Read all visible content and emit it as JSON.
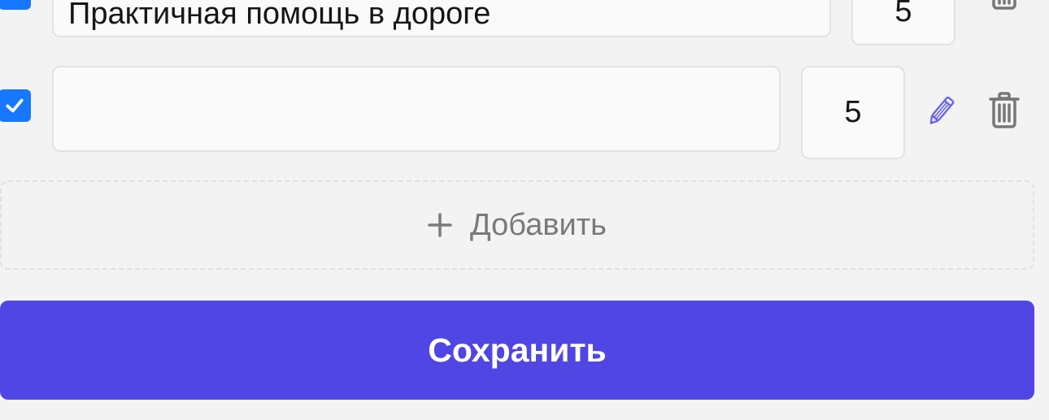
{
  "rows": [
    {
      "checked": true,
      "text": "Практичная помощь в дороге",
      "quantity": "5"
    },
    {
      "checked": true,
      "text": "",
      "quantity": "5"
    }
  ],
  "icons": {
    "checkbox": "check-icon",
    "edit": "pencil-icon",
    "delete": "trash-icon",
    "add": "plus-icon"
  },
  "add_button": {
    "label": "Добавить"
  },
  "save_button": {
    "label": "Сохранить"
  },
  "colors": {
    "accent": "#5046e4",
    "checkbox": "#1677ff",
    "edit_icon": "#6b64e8",
    "muted_icon": "#767676"
  }
}
